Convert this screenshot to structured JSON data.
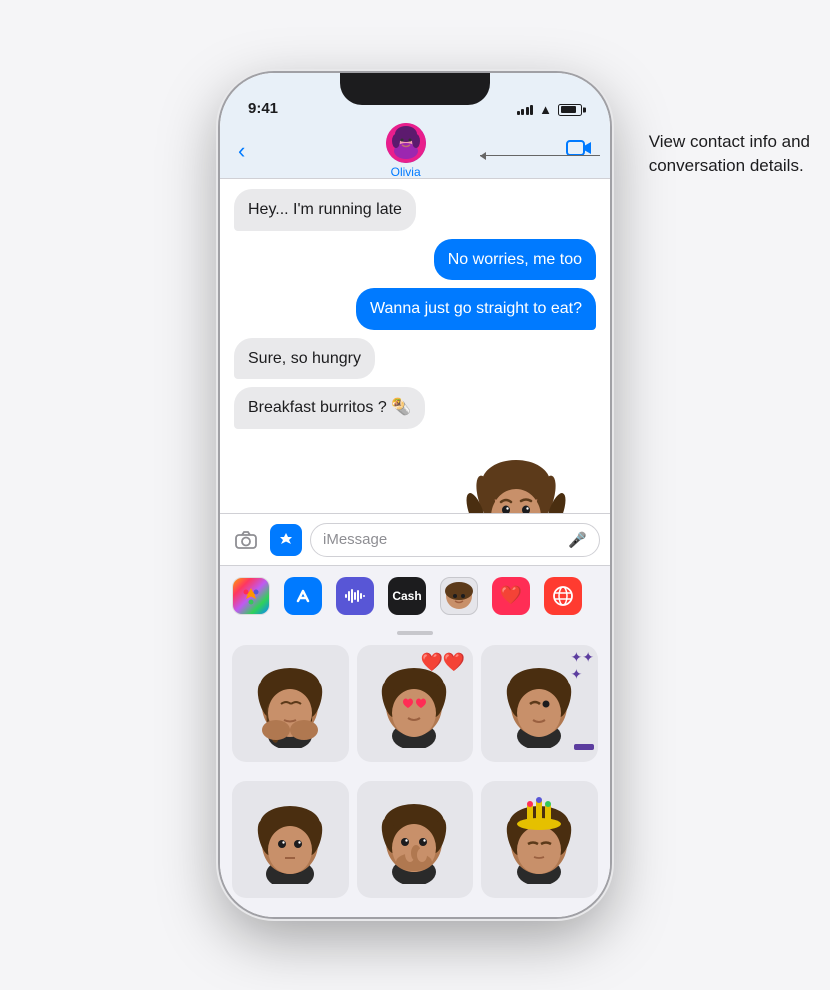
{
  "statusBar": {
    "time": "9:41",
    "signalBars": [
      4,
      6,
      8,
      10,
      12
    ],
    "batteryPercent": 80
  },
  "navHeader": {
    "backLabel": "‹",
    "contactName": "Olivia",
    "videoButtonLabel": "📹"
  },
  "messages": [
    {
      "id": 1,
      "type": "received",
      "text": "Hey... I'm running late"
    },
    {
      "id": 2,
      "type": "sent",
      "text": "No worries, me too"
    },
    {
      "id": 3,
      "type": "sent",
      "text": "Wanna just go straight to eat?"
    },
    {
      "id": 4,
      "type": "received",
      "text": "Sure, so hungry"
    },
    {
      "id": 5,
      "type": "received",
      "text": "Breakfast burritos ? 🌯"
    },
    {
      "id": 6,
      "type": "memoji",
      "emoji": "🤔"
    }
  ],
  "inputBar": {
    "cameraIcon": "📷",
    "appStoreIcon": "A",
    "placeholder": "iMessage",
    "micIcon": "🎤"
  },
  "appDrawer": {
    "apps": [
      {
        "name": "Photos",
        "color": "#fff",
        "icon": "🌅",
        "label": "photos-app"
      },
      {
        "name": "App Store",
        "color": "#007aff",
        "icon": "Ⓐ",
        "label": "appstore-app"
      },
      {
        "name": "Audio",
        "color": "#5856d6",
        "icon": "≋",
        "label": "audio-app"
      },
      {
        "name": "Cash",
        "color": "#1c1c1e",
        "icon": "₿",
        "label": "cash-app"
      },
      {
        "name": "Memoji",
        "color": "#e5e5ea",
        "icon": "😊",
        "label": "memoji-app"
      },
      {
        "name": "Stickers",
        "color": "#ff2d55",
        "icon": "❤",
        "label": "stickers-app"
      },
      {
        "name": "More",
        "color": "#ff3b30",
        "icon": "🔍",
        "label": "more-app"
      }
    ]
  },
  "memojiPanel": {
    "items": [
      {
        "id": 1,
        "variant": "praying",
        "label": "memoji-praying"
      },
      {
        "id": 2,
        "variant": "hearts",
        "label": "memoji-hearts"
      },
      {
        "id": 3,
        "variant": "sparkle",
        "label": "memoji-sparkle"
      },
      {
        "id": 4,
        "variant": "neutral",
        "label": "memoji-neutral"
      },
      {
        "id": 5,
        "variant": "gasp",
        "label": "memoji-gasp"
      },
      {
        "id": 6,
        "variant": "hat",
        "label": "memoji-hat"
      }
    ]
  },
  "annotation": {
    "line1": "View contact info and",
    "line2": "conversation details."
  }
}
